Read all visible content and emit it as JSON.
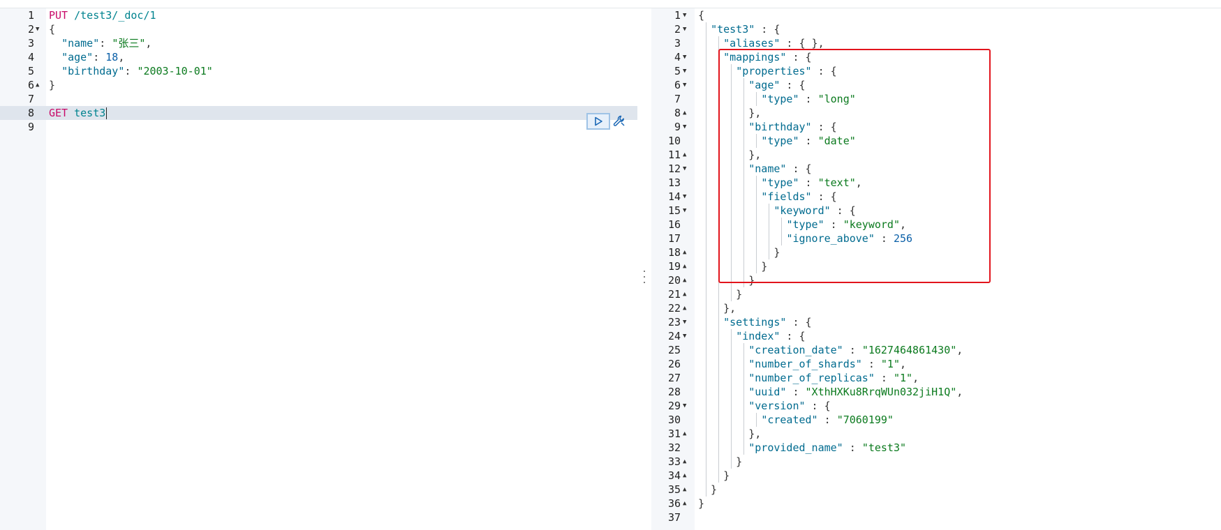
{
  "request_editor": {
    "lines": [
      {
        "n": "1",
        "fold": "",
        "parts": [
          [
            "m",
            "PUT "
          ],
          [
            "u",
            "/test3/_doc/1"
          ]
        ]
      },
      {
        "n": "2",
        "fold": "▼",
        "parts": [
          [
            "p",
            "{"
          ]
        ]
      },
      {
        "n": "3",
        "fold": "",
        "parts": [
          [
            "p",
            "  "
          ],
          [
            "k",
            "\"name\""
          ],
          [
            "p",
            ": "
          ],
          [
            "s",
            "\"张三\""
          ],
          [
            "p",
            ","
          ]
        ]
      },
      {
        "n": "4",
        "fold": "",
        "parts": [
          [
            "p",
            "  "
          ],
          [
            "k",
            "\"age\""
          ],
          [
            "p",
            ": "
          ],
          [
            "n",
            "18"
          ],
          [
            "p",
            ","
          ]
        ]
      },
      {
        "n": "5",
        "fold": "",
        "parts": [
          [
            "p",
            "  "
          ],
          [
            "k",
            "\"birthday\""
          ],
          [
            "p",
            ": "
          ],
          [
            "s",
            "\"2003-10-01\""
          ]
        ]
      },
      {
        "n": "6",
        "fold": "▲",
        "parts": [
          [
            "p",
            "}"
          ]
        ]
      },
      {
        "n": "7",
        "fold": "",
        "parts": []
      },
      {
        "n": "8",
        "fold": "",
        "parts": [
          [
            "m",
            "GET "
          ],
          [
            "u",
            "test3"
          ]
        ],
        "active": true
      },
      {
        "n": "9",
        "fold": "",
        "parts": []
      }
    ]
  },
  "response_viewer": {
    "lines": [
      {
        "n": "1",
        "fold": "▼",
        "parts": [
          [
            "p",
            "{"
          ]
        ]
      },
      {
        "n": "2",
        "fold": "▼",
        "parts": [
          [
            "p",
            "  "
          ],
          [
            "k",
            "\"test3\""
          ],
          [
            "p",
            " : {"
          ]
        ]
      },
      {
        "n": "3",
        "fold": "",
        "parts": [
          [
            "p",
            "    "
          ],
          [
            "k",
            "\"aliases\""
          ],
          [
            "p",
            " : { },"
          ]
        ]
      },
      {
        "n": "4",
        "fold": "▼",
        "parts": [
          [
            "p",
            "    "
          ],
          [
            "k",
            "\"mappings\""
          ],
          [
            "p",
            " : {"
          ]
        ]
      },
      {
        "n": "5",
        "fold": "▼",
        "parts": [
          [
            "p",
            "      "
          ],
          [
            "k",
            "\"properties\""
          ],
          [
            "p",
            " : {"
          ]
        ]
      },
      {
        "n": "6",
        "fold": "▼",
        "parts": [
          [
            "p",
            "        "
          ],
          [
            "k",
            "\"age\""
          ],
          [
            "p",
            " : {"
          ]
        ]
      },
      {
        "n": "7",
        "fold": "",
        "parts": [
          [
            "p",
            "          "
          ],
          [
            "k",
            "\"type\""
          ],
          [
            "p",
            " : "
          ],
          [
            "s",
            "\"long\""
          ]
        ]
      },
      {
        "n": "8",
        "fold": "▲",
        "parts": [
          [
            "p",
            "        },"
          ]
        ]
      },
      {
        "n": "9",
        "fold": "▼",
        "parts": [
          [
            "p",
            "        "
          ],
          [
            "k",
            "\"birthday\""
          ],
          [
            "p",
            " : {"
          ]
        ]
      },
      {
        "n": "10",
        "fold": "",
        "parts": [
          [
            "p",
            "          "
          ],
          [
            "k",
            "\"type\""
          ],
          [
            "p",
            " : "
          ],
          [
            "s",
            "\"date\""
          ]
        ]
      },
      {
        "n": "11",
        "fold": "▲",
        "parts": [
          [
            "p",
            "        },"
          ]
        ]
      },
      {
        "n": "12",
        "fold": "▼",
        "parts": [
          [
            "p",
            "        "
          ],
          [
            "k",
            "\"name\""
          ],
          [
            "p",
            " : {"
          ]
        ]
      },
      {
        "n": "13",
        "fold": "",
        "parts": [
          [
            "p",
            "          "
          ],
          [
            "k",
            "\"type\""
          ],
          [
            "p",
            " : "
          ],
          [
            "s",
            "\"text\""
          ],
          [
            "p",
            ","
          ]
        ]
      },
      {
        "n": "14",
        "fold": "▼",
        "parts": [
          [
            "p",
            "          "
          ],
          [
            "k",
            "\"fields\""
          ],
          [
            "p",
            " : {"
          ]
        ]
      },
      {
        "n": "15",
        "fold": "▼",
        "parts": [
          [
            "p",
            "            "
          ],
          [
            "k",
            "\"keyword\""
          ],
          [
            "p",
            " : {"
          ]
        ]
      },
      {
        "n": "16",
        "fold": "",
        "parts": [
          [
            "p",
            "              "
          ],
          [
            "k",
            "\"type\""
          ],
          [
            "p",
            " : "
          ],
          [
            "s",
            "\"keyword\""
          ],
          [
            "p",
            ","
          ]
        ]
      },
      {
        "n": "17",
        "fold": "",
        "parts": [
          [
            "p",
            "              "
          ],
          [
            "k",
            "\"ignore_above\""
          ],
          [
            "p",
            " : "
          ],
          [
            "n",
            "256"
          ]
        ]
      },
      {
        "n": "18",
        "fold": "▲",
        "parts": [
          [
            "p",
            "            }"
          ]
        ]
      },
      {
        "n": "19",
        "fold": "▲",
        "parts": [
          [
            "p",
            "          }"
          ]
        ]
      },
      {
        "n": "20",
        "fold": "▲",
        "parts": [
          [
            "p",
            "        }"
          ]
        ]
      },
      {
        "n": "21",
        "fold": "▲",
        "parts": [
          [
            "p",
            "      }"
          ]
        ]
      },
      {
        "n": "22",
        "fold": "▲",
        "parts": [
          [
            "p",
            "    },"
          ]
        ]
      },
      {
        "n": "23",
        "fold": "▼",
        "parts": [
          [
            "p",
            "    "
          ],
          [
            "k",
            "\"settings\""
          ],
          [
            "p",
            " : {"
          ]
        ]
      },
      {
        "n": "24",
        "fold": "▼",
        "parts": [
          [
            "p",
            "      "
          ],
          [
            "k",
            "\"index\""
          ],
          [
            "p",
            " : {"
          ]
        ]
      },
      {
        "n": "25",
        "fold": "",
        "parts": [
          [
            "p",
            "        "
          ],
          [
            "k",
            "\"creation_date\""
          ],
          [
            "p",
            " : "
          ],
          [
            "s",
            "\"1627464861430\""
          ],
          [
            "p",
            ","
          ]
        ]
      },
      {
        "n": "26",
        "fold": "",
        "parts": [
          [
            "p",
            "        "
          ],
          [
            "k",
            "\"number_of_shards\""
          ],
          [
            "p",
            " : "
          ],
          [
            "s",
            "\"1\""
          ],
          [
            "p",
            ","
          ]
        ]
      },
      {
        "n": "27",
        "fold": "",
        "parts": [
          [
            "p",
            "        "
          ],
          [
            "k",
            "\"number_of_replicas\""
          ],
          [
            "p",
            " : "
          ],
          [
            "s",
            "\"1\""
          ],
          [
            "p",
            ","
          ]
        ]
      },
      {
        "n": "28",
        "fold": "",
        "parts": [
          [
            "p",
            "        "
          ],
          [
            "k",
            "\"uuid\""
          ],
          [
            "p",
            " : "
          ],
          [
            "s",
            "\"XthHXKu8RrqWUn032jiH1Q\""
          ],
          [
            "p",
            ","
          ]
        ]
      },
      {
        "n": "29",
        "fold": "▼",
        "parts": [
          [
            "p",
            "        "
          ],
          [
            "k",
            "\"version\""
          ],
          [
            "p",
            " : {"
          ]
        ]
      },
      {
        "n": "30",
        "fold": "",
        "parts": [
          [
            "p",
            "          "
          ],
          [
            "k",
            "\"created\""
          ],
          [
            "p",
            " : "
          ],
          [
            "s",
            "\"7060199\""
          ]
        ]
      },
      {
        "n": "31",
        "fold": "▲",
        "parts": [
          [
            "p",
            "        },"
          ]
        ]
      },
      {
        "n": "32",
        "fold": "",
        "parts": [
          [
            "p",
            "        "
          ],
          [
            "k",
            "\"provided_name\""
          ],
          [
            "p",
            " : "
          ],
          [
            "s",
            "\"test3\""
          ]
        ]
      },
      {
        "n": "33",
        "fold": "▲",
        "parts": [
          [
            "p",
            "      }"
          ]
        ]
      },
      {
        "n": "34",
        "fold": "▲",
        "parts": [
          [
            "p",
            "    }"
          ]
        ]
      },
      {
        "n": "35",
        "fold": "▲",
        "parts": [
          [
            "p",
            "  }"
          ]
        ]
      },
      {
        "n": "36",
        "fold": "▲",
        "parts": [
          [
            "p",
            "}"
          ]
        ]
      },
      {
        "n": "37",
        "fold": "",
        "parts": []
      }
    ]
  },
  "toolbar": {
    "run_icon": "play-icon",
    "wrench_icon": "wrench-icon"
  },
  "colors": {
    "method": "#c80a68",
    "url": "#00838f",
    "key": "#006b8f",
    "string": "#0b7a1e",
    "number": "#0b60a8",
    "highlight_box": "#e2141c",
    "active_line": "#dfe5ed"
  }
}
